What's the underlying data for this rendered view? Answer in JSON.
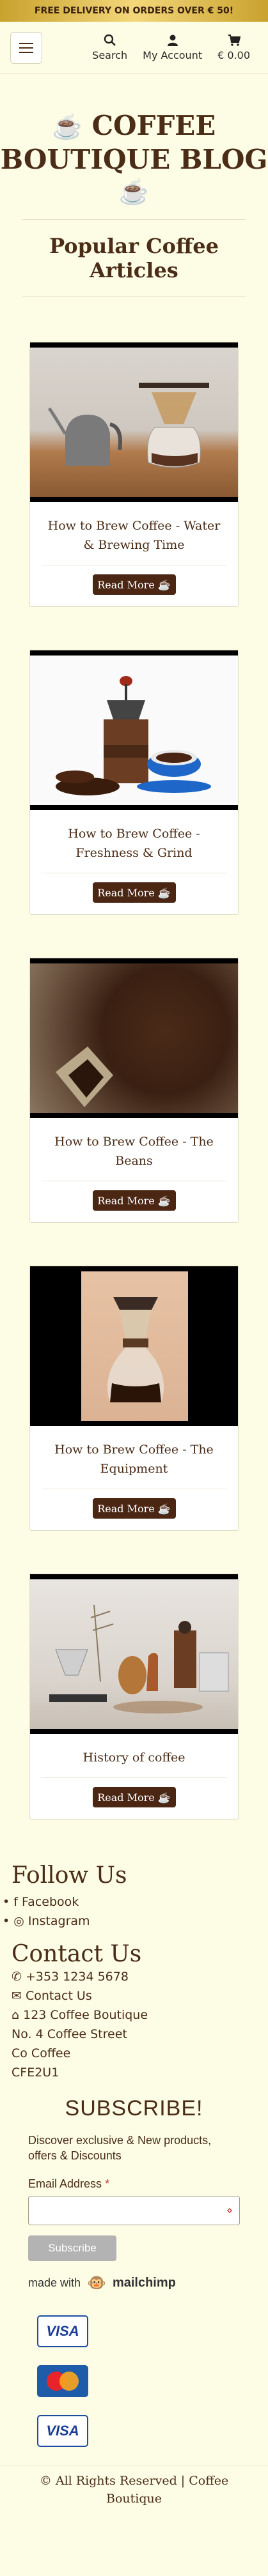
{
  "topbar": {
    "text": "FREE DELIVERY ON ORDERS OVER € 50!"
  },
  "nav": {
    "search": "Search",
    "account": "My Account",
    "cart": "€ 0.00"
  },
  "blog": {
    "title": "COFFEE BOUTIQUE BLOG"
  },
  "section": {
    "heading": "Popular Coffee Articles"
  },
  "articles": [
    {
      "title": "How to Brew Coffee - Water & Brewing Time",
      "button": "Read More"
    },
    {
      "title": "How to Brew Coffee - Freshness & Grind",
      "button": "Read More"
    },
    {
      "title": "How to Brew Coffee - The Beans",
      "button": "Read More"
    },
    {
      "title": "How to Brew Coffee - The Equipment",
      "button": "Read More"
    },
    {
      "title": "History of coffee",
      "button": "Read More"
    }
  ],
  "follow": {
    "heading": "Follow Us",
    "links": [
      "Facebook",
      "Instagram"
    ]
  },
  "contact": {
    "heading": "Contact Us",
    "phone": "+353 1234 5678",
    "email": "Contact Us",
    "address_line1": "123 Coffee Boutique",
    "address_line2": "No. 4 Coffee Street",
    "address_line3": "Co Coffee",
    "address_line4": "CFE2U1"
  },
  "subscribe": {
    "heading": "SUBSCRIBE!",
    "description": "Discover exclusive & New products, offers & Discounts",
    "email_label": "Email Address",
    "button": "Subscribe",
    "made_with": "made with",
    "brand": "mailchimp"
  },
  "payment": {
    "cards": [
      "VISA",
      "MasterCard",
      "VISA"
    ]
  },
  "footer": {
    "text": "© All Rights Reserved | Coffee Boutique"
  },
  "colors": {
    "brand_brown": "#4a2613",
    "background": "#fdfde6",
    "gold": "#e0c060"
  }
}
